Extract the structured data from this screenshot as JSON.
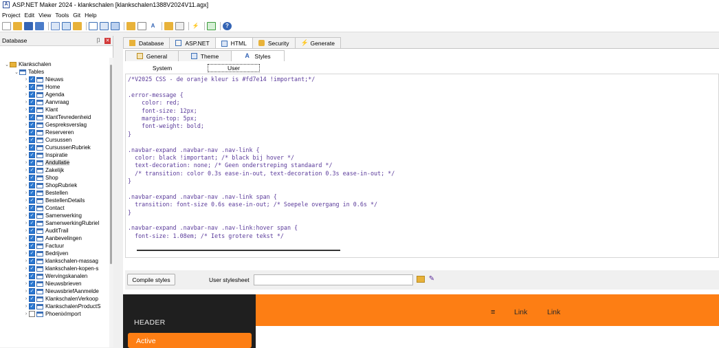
{
  "window": {
    "title": "ASP.NET Maker 2024 - klankschalen [klankschalen1388V2024V11.agx]"
  },
  "menu": [
    "Project",
    "Edit",
    "View",
    "Tools",
    "Git",
    "Help"
  ],
  "left_panel": {
    "title": "Database",
    "root": "Klankschalen",
    "tables_label": "Tables",
    "tables": [
      {
        "name": "Nieuws",
        "checked": true
      },
      {
        "name": "Home",
        "checked": true
      },
      {
        "name": "Agenda",
        "checked": true
      },
      {
        "name": "Aanvraag",
        "checked": true
      },
      {
        "name": "Klant",
        "checked": true
      },
      {
        "name": "KlantTevredenheid",
        "checked": true
      },
      {
        "name": "Gespreksverslag",
        "checked": true
      },
      {
        "name": "Reserveren",
        "checked": true
      },
      {
        "name": "Cursussen",
        "checked": true
      },
      {
        "name": "CursussenRubriek",
        "checked": true
      },
      {
        "name": "Inspiratie",
        "checked": true
      },
      {
        "name": "Andullatie",
        "checked": true
      },
      {
        "name": "Zakelijk",
        "checked": true
      },
      {
        "name": "Shop",
        "checked": true
      },
      {
        "name": "ShopRubriek",
        "checked": true
      },
      {
        "name": "Bestellen",
        "checked": true
      },
      {
        "name": "BestellenDetails",
        "checked": true
      },
      {
        "name": "Contact",
        "checked": true
      },
      {
        "name": "Samenwerking",
        "checked": true
      },
      {
        "name": "SamenwerkingRubriel",
        "checked": true
      },
      {
        "name": "AuditTrail",
        "checked": true
      },
      {
        "name": "Aanbevelingen",
        "checked": true
      },
      {
        "name": "Factuur",
        "checked": true
      },
      {
        "name": "Bedrijven",
        "checked": true
      },
      {
        "name": "klankschalen-massag",
        "checked": true
      },
      {
        "name": "klankschalen-kopen-s",
        "checked": true
      },
      {
        "name": "Wervingskanalen",
        "checked": true
      },
      {
        "name": "Nieuwsbrieven",
        "checked": true
      },
      {
        "name": "NieuwsbriefAanmelde",
        "checked": true
      },
      {
        "name": "KlankschalenVerkoop",
        "checked": true
      },
      {
        "name": "KlankschalenProductS",
        "checked": true
      },
      {
        "name": "PhoenixImport",
        "checked": false
      }
    ],
    "selected": "Andullatie"
  },
  "tabs": [
    "Database",
    "ASP.NET",
    "HTML",
    "Security",
    "Generate"
  ],
  "active_tab": "HTML",
  "subtabs": [
    "General",
    "Theme",
    "Styles"
  ],
  "active_subtab": "Styles",
  "style_tabs": [
    "System",
    "User"
  ],
  "active_style_tab": "User",
  "code_lines": [
    "/*V2025 CSS - de oranje kleur is #fd7e14 !important;*/",
    "",
    ".error-message {",
    "    color: red;",
    "    font-size: 12px;",
    "    margin-top: 5px;",
    "    font-weight: bold;",
    "}",
    "",
    ".navbar-expand .navbar-nav .nav-link {",
    "  color: black !important; /* black bij hover */",
    "  text-decoration: none; /* Geen onderstreping standaard */",
    "  /* transition: color 0.3s ease-in-out, text-decoration 0.3s ease-in-out; */",
    "}",
    "",
    ".navbar-expand .navbar-nav .nav-link span {",
    "  transition: font-size 0.6s ease-in-out; /* Soepele overgang in 0.6s */",
    "}",
    "",
    ".navbar-expand .navbar-nav .nav-link:hover span {",
    "  font-size: 1.08em; /* Iets grotere tekst */"
  ],
  "bottom": {
    "compile_label": "Compile styles",
    "user_stylesheet_label": "User stylesheet",
    "user_stylesheet_value": ""
  },
  "preview": {
    "header": "HEADER",
    "active": "Active",
    "links": [
      "Link",
      "Link"
    ],
    "accent": "#fd7e14",
    "sidebar_bg": "#1f1f1f"
  }
}
